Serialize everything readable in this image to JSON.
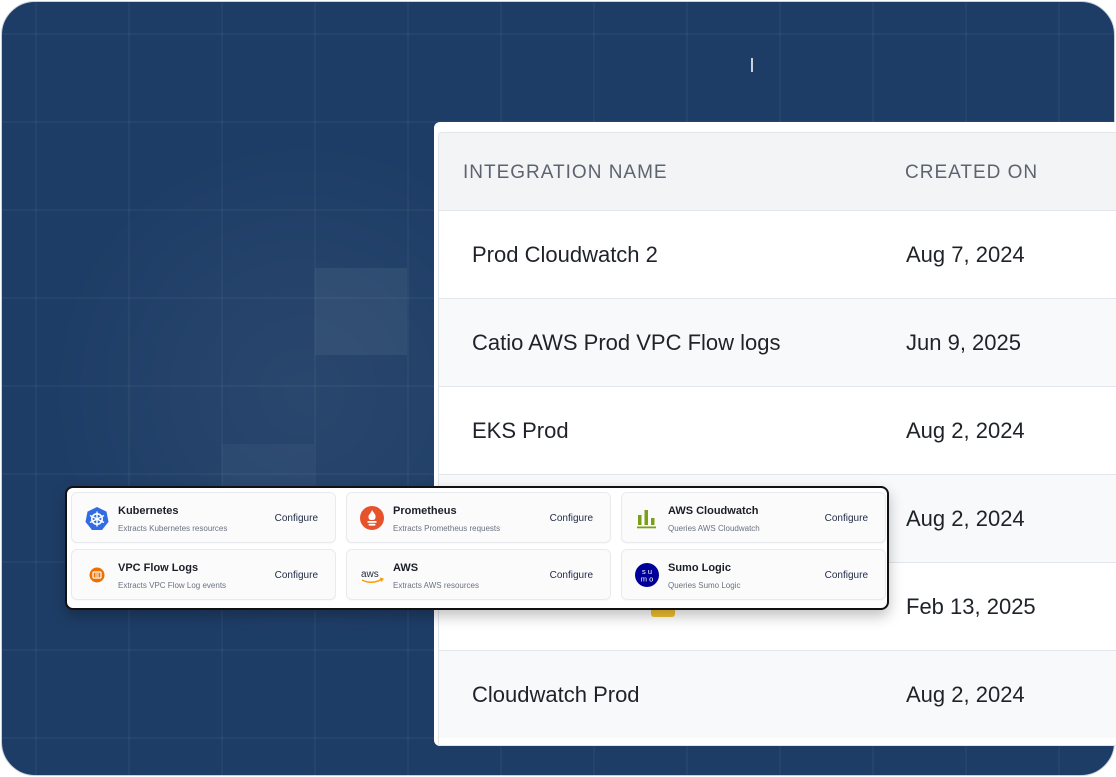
{
  "table": {
    "headers": {
      "name": "INTEGRATION NAME",
      "created": "CREATED ON"
    },
    "rows": [
      {
        "name": "Prod Cloudwatch 2",
        "created": "Aug 7, 2024"
      },
      {
        "name": "Catio AWS Prod VPC Flow logs",
        "created": "Jun 9, 2025"
      },
      {
        "name": "EKS Prod",
        "created": "Aug 2, 2024"
      },
      {
        "name": "",
        "created": "Aug 2, 2024"
      },
      {
        "name": "",
        "created": "Feb 13, 2025"
      },
      {
        "name": "Cloudwatch Prod",
        "created": "Aug 2, 2024"
      }
    ]
  },
  "integrations": [
    {
      "name": "Kubernetes",
      "desc": "Extracts Kubernetes resources",
      "action": "Configure",
      "icon": "kubernetes-icon"
    },
    {
      "name": "Prometheus",
      "desc": "Extracts Prometheus requests",
      "action": "Configure",
      "icon": "prometheus-icon"
    },
    {
      "name": "AWS Cloudwatch",
      "desc": "Queries AWS Cloudwatch",
      "action": "Configure",
      "icon": "cloudwatch-icon"
    },
    {
      "name": "VPC Flow Logs",
      "desc": "Extracts VPC Flow Log events",
      "action": "Configure",
      "icon": "vpc-flow-logs-icon"
    },
    {
      "name": "AWS",
      "desc": "Extracts AWS resources",
      "action": "Configure",
      "icon": "aws-icon"
    },
    {
      "name": "Sumo Logic",
      "desc": "Queries Sumo Logic",
      "action": "Configure",
      "icon": "sumo-logic-icon",
      "icon_text": "su mo"
    }
  ],
  "colors": {
    "background": "#1e3d66",
    "kubernetes": "#326ce5",
    "prometheus": "#e6522c",
    "cloudwatch": "#7aa116",
    "vpc": "#ed7100",
    "aws": "#ff9900",
    "sumo": "#000099"
  }
}
